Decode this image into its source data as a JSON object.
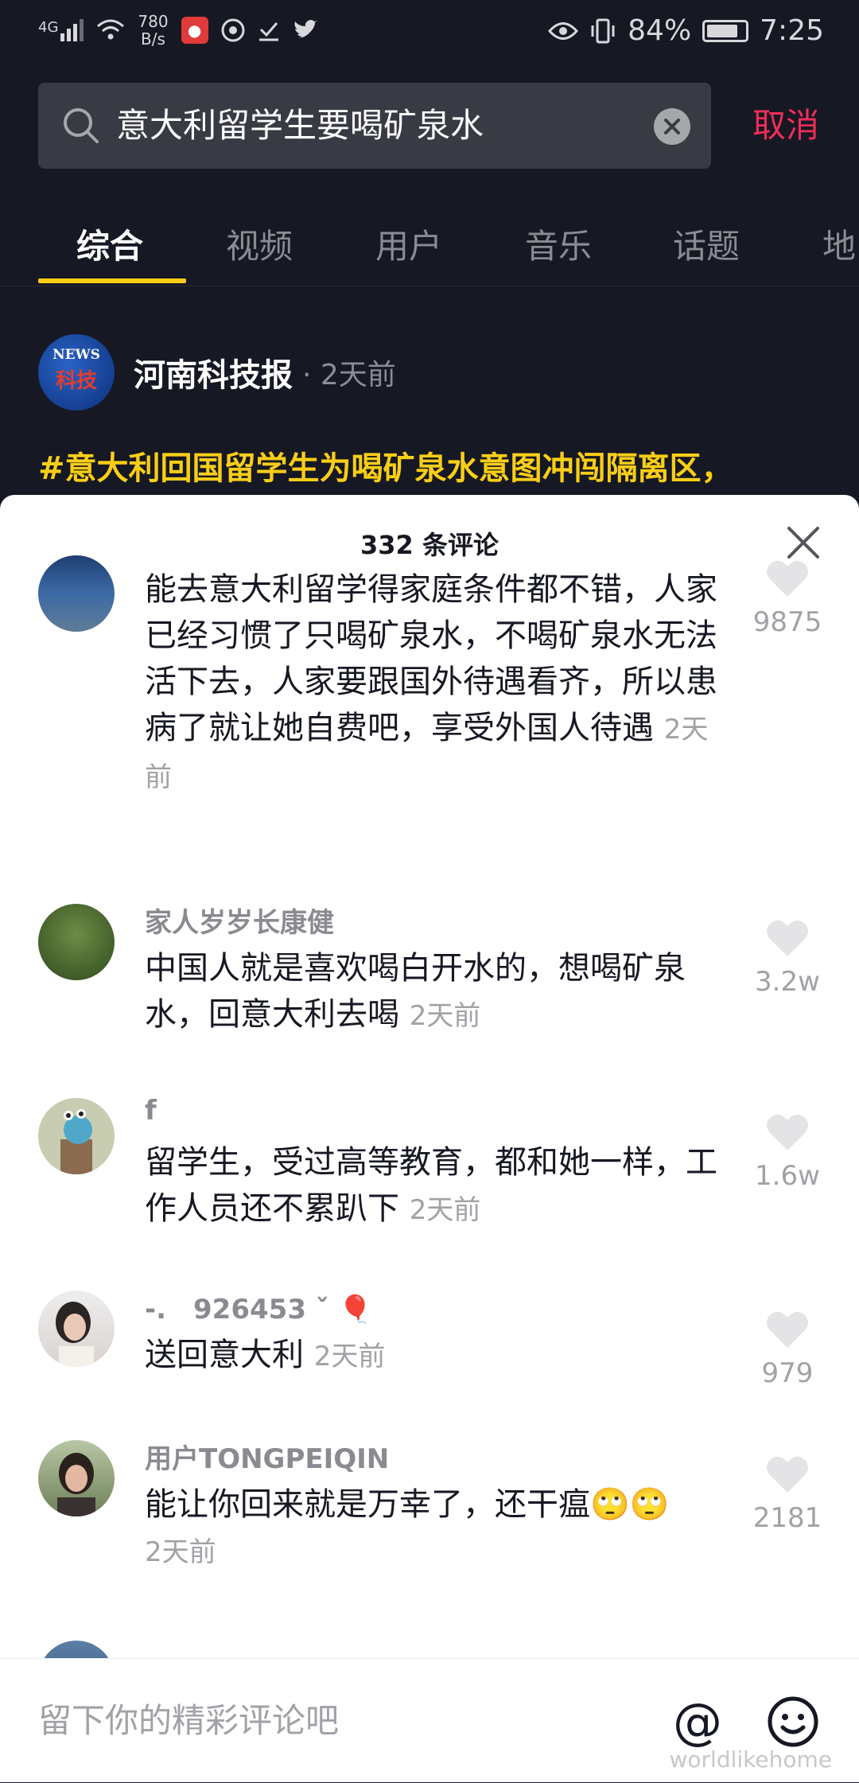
{
  "status_bar": {
    "network": "4G",
    "speed_value": "780",
    "speed_unit": "B/s",
    "battery": "84%",
    "battery_level": 0.84,
    "time": "7:25"
  },
  "search": {
    "query": "意大利留学生要喝矿泉水",
    "cancel_label": "取消"
  },
  "tabs": [
    {
      "label": "综合",
      "active": true
    },
    {
      "label": "视频",
      "active": false
    },
    {
      "label": "用户",
      "active": false
    },
    {
      "label": "音乐",
      "active": false
    },
    {
      "label": "话题",
      "active": false
    },
    {
      "label": "地",
      "active": false
    }
  ],
  "post": {
    "avatar_text_top": "NEWS",
    "avatar_text_main": "科技",
    "author": "河南科技报",
    "time": "· 2天前",
    "hashtag": "#意大利回国留学生为喝矿泉水意图冲闯隔离区，"
  },
  "comments_sheet": {
    "title": "332 条评论",
    "comments": [
      {
        "name": "",
        "text": "能去意大利留学得家庭条件都不错，人家已经习惯了只喝矿泉水，不喝矿泉水无法活下去，人家要跟国外待遇看齐，所以患病了就让她自费吧，享受外国人待遇",
        "time": "2天前",
        "likes": "9875"
      },
      {
        "name": "家人岁岁长康健",
        "text": "中国人就是喜欢喝白开水的，想喝矿泉水，回意大利去喝",
        "time": "2天前",
        "likes": "3.2w"
      },
      {
        "name": "f",
        "text": "留学生，受过高等教育，都和她一样，工作人员还不累趴下",
        "time": "2天前",
        "likes": "1.6w"
      },
      {
        "name": "-.　926453 ˇ 🎈",
        "text": "送回意大利",
        "time": "2天前",
        "likes": "979"
      },
      {
        "name": "用户TONGPEIQIN",
        "text": "能让你回来就是万幸了，还干瘟🙄🙄",
        "time": "2天前",
        "likes": "2181"
      }
    ]
  },
  "bottom_bar": {
    "placeholder": "留下你的精彩评论吧",
    "watermark": "worldlikehome"
  }
}
